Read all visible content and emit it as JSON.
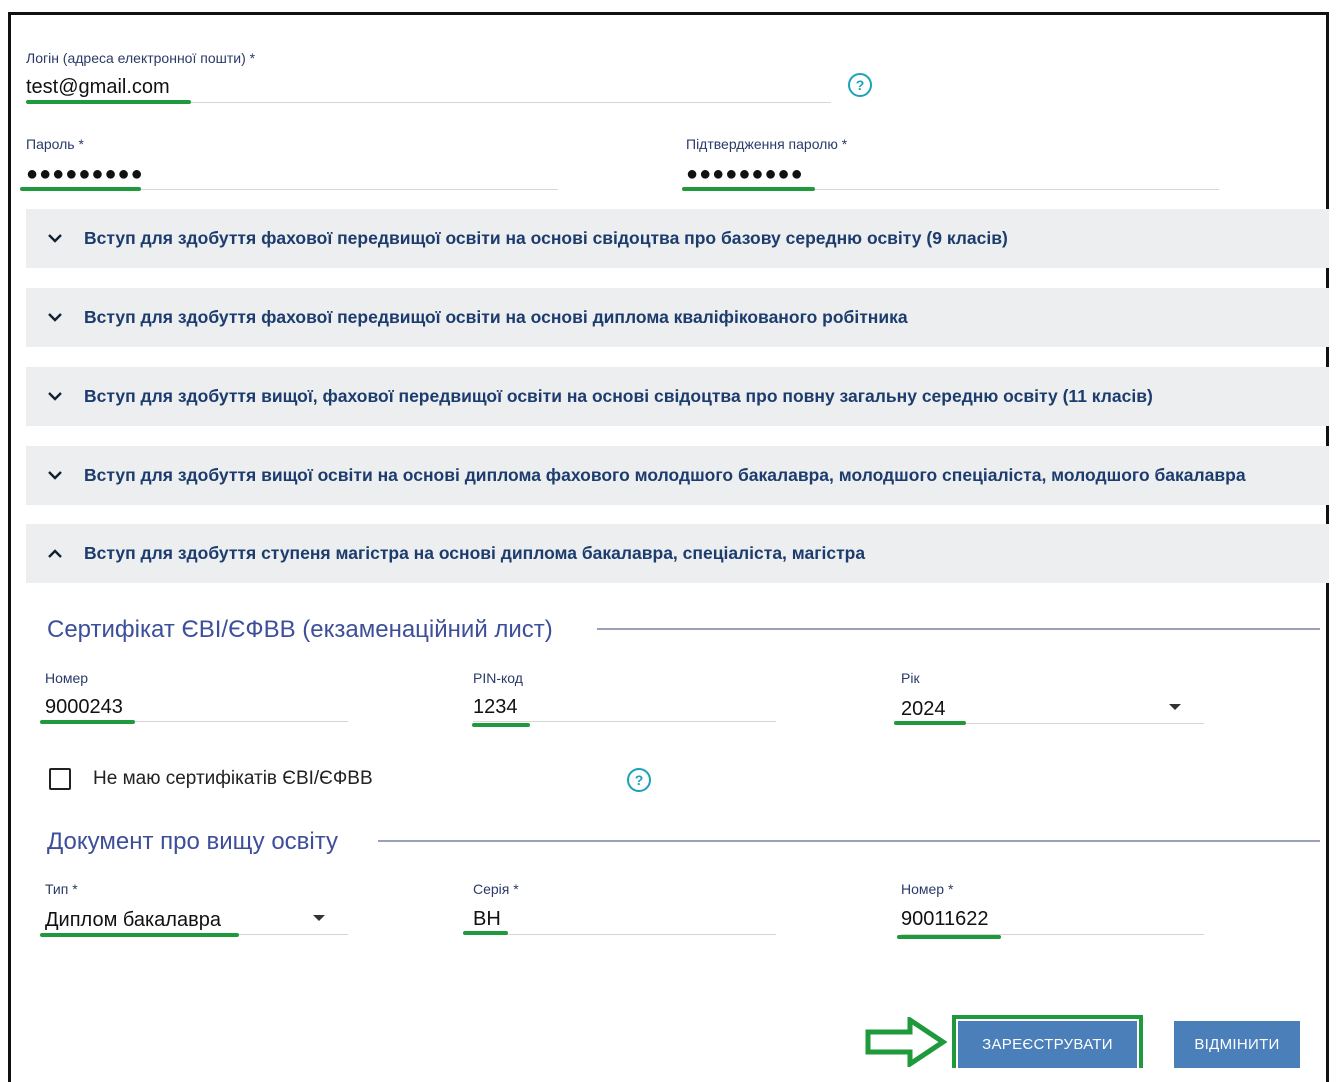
{
  "login": {
    "label": "Логін (адреса електронної пошти) *",
    "value": "test@gmail.com",
    "help_icon": "question-circle-icon"
  },
  "password": {
    "label": "Пароль *",
    "value": "●●●●●●●●●"
  },
  "password_confirm": {
    "label": "Підтвердження паролю *",
    "value": "●●●●●●●●●"
  },
  "panels": [
    {
      "title": "Вступ для здобуття фахової передвищої освіти на основі свідоцтва про базову середню освіту (9 класів)",
      "expanded": false
    },
    {
      "title": "Вступ для здобуття фахової передвищої освіти на основі диплома кваліфікованого робітника",
      "expanded": false
    },
    {
      "title": "Вступ для здобуття вищої, фахової передвищої освіти на основі свідоцтва про повну загальну середню освіту (11 класів)",
      "expanded": false
    },
    {
      "title": "Вступ для здобуття вищої освіти на основі диплома фахового молодшого бакалавра, молодшого спеціаліста, молодшого бакалавра",
      "expanded": false
    },
    {
      "title": "Вступ для здобуття ступеня магістра на основі диплома бакалавра, спеціаліста, магістра",
      "expanded": true
    }
  ],
  "certificate": {
    "section_title": "Сертифікат ЄВІ/ЄФВВ (екзаменаційний лист)",
    "number_label": "Номер",
    "number_value": "9000243",
    "pin_label": "PIN-код",
    "pin_value": "1234",
    "year_label": "Рік",
    "year_value": "2024",
    "no_cert_label": "Не маю сертифікатів ЄВІ/ЄФВВ",
    "no_cert_checked": false
  },
  "document": {
    "section_title": "Документ про вищу освіту",
    "type_label": "Тип *",
    "type_value": "Диплом бакалавра",
    "series_label": "Серія *",
    "series_value": "ВН",
    "number_label": "Номер *",
    "number_value": "90011622"
  },
  "actions": {
    "register_label": "ЗАРЕЄСТРУВАТИ",
    "cancel_label": "ВІДМІНИТИ"
  },
  "colors": {
    "highlight": "#1e9a3c",
    "button": "#4a7fba",
    "panel_bg": "#eceeef",
    "panel_text": "#1d3c6e",
    "section_title": "#3d4f9a",
    "help_icon": "#1aa3b8"
  }
}
